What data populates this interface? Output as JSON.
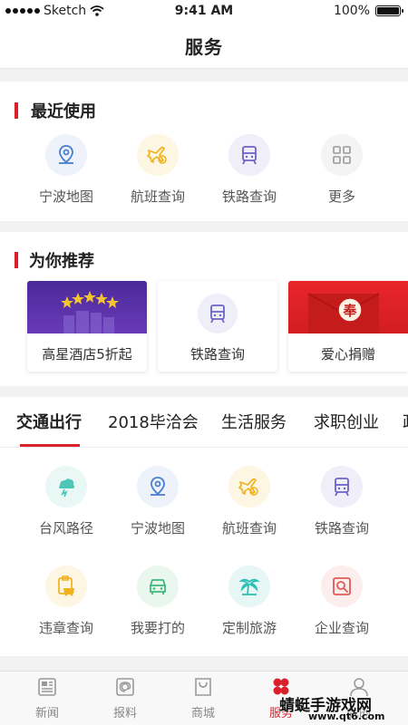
{
  "status": {
    "carrier": "Sketch",
    "time": "9:41 AM",
    "battery": "100%",
    "battery_level": 1.0
  },
  "nav": {
    "title": "服务"
  },
  "recent": {
    "title": "最近使用",
    "items": [
      {
        "label": "宁波地图",
        "icon": "map-pin-icon"
      },
      {
        "label": "航班查询",
        "icon": "plane-icon"
      },
      {
        "label": "铁路查询",
        "icon": "train-icon"
      },
      {
        "label": "更多",
        "icon": "grid-icon"
      }
    ]
  },
  "recommend": {
    "title": "为你推荐",
    "cards": [
      {
        "label": "高星酒店5折起",
        "icon": "hotel-icon"
      },
      {
        "label": "铁路查询",
        "icon": "train-icon"
      },
      {
        "label": "爱心捐赠",
        "icon": "red-envelope-icon",
        "badge": "奉"
      }
    ]
  },
  "category": {
    "tabs": [
      "交通出行",
      "2018毕洽会",
      "生活服务",
      "求职创业",
      "政"
    ],
    "active_tab": 0,
    "items": [
      {
        "label": "台风路径",
        "icon": "typhoon-icon"
      },
      {
        "label": "宁波地图",
        "icon": "map-pin-icon"
      },
      {
        "label": "航班查询",
        "icon": "plane-icon"
      },
      {
        "label": "铁路查询",
        "icon": "train-icon"
      },
      {
        "label": "违章查询",
        "icon": "violation-icon"
      },
      {
        "label": "我要打的",
        "icon": "taxi-icon"
      },
      {
        "label": "定制旅游",
        "icon": "travel-icon"
      },
      {
        "label": "企业查询",
        "icon": "company-search-icon"
      }
    ]
  },
  "bottom_tabs": [
    {
      "label": "新闻",
      "icon": "news-icon"
    },
    {
      "label": "报料",
      "icon": "report-icon"
    },
    {
      "label": "商城",
      "icon": "shop-icon"
    },
    {
      "label": "服务",
      "icon": "service-icon",
      "active": true
    },
    {
      "label": "我的",
      "icon": "user-icon"
    }
  ],
  "watermark": {
    "text": "蜻蜓手游戏网",
    "url": "www.qt6.com"
  },
  "colors": {
    "accent": "#d9202b",
    "blue": "#4a7fd0",
    "yellow": "#f0b21e",
    "purple": "#6c63c9",
    "green": "#3cb87a",
    "teal": "#2bbfb3"
  }
}
